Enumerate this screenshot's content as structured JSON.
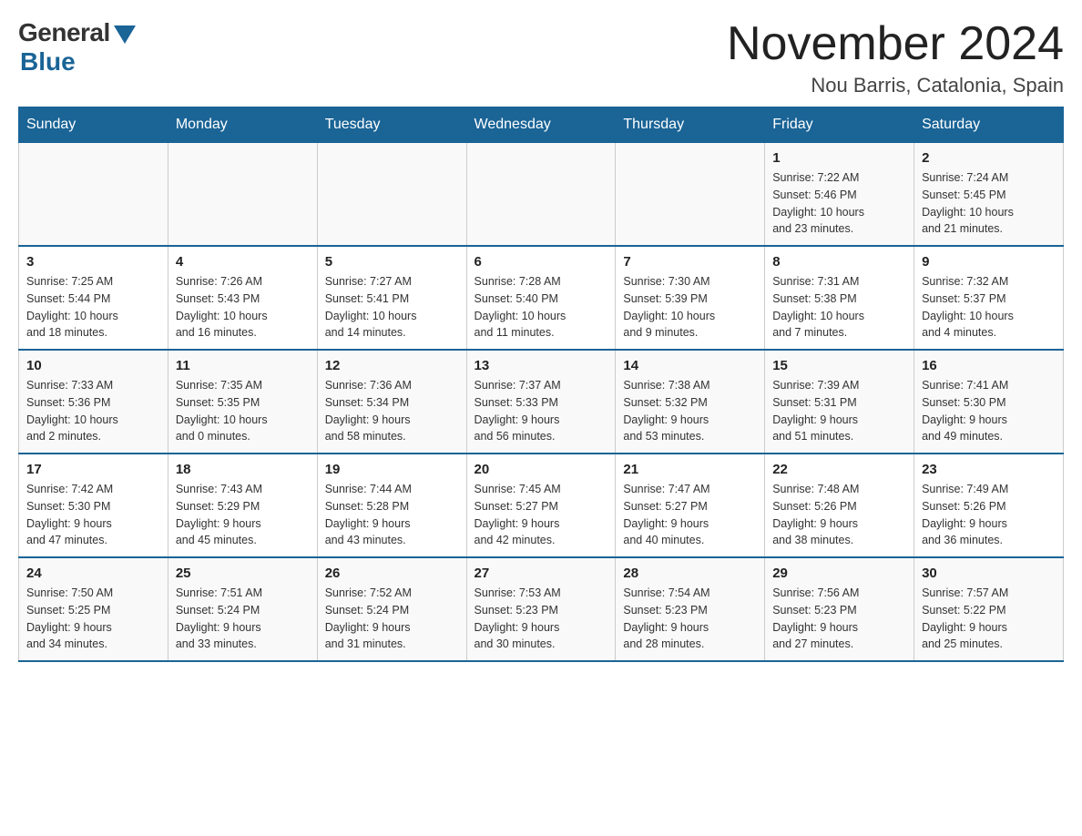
{
  "logo": {
    "general": "General",
    "blue": "Blue"
  },
  "title": "November 2024",
  "location": "Nou Barris, Catalonia, Spain",
  "weekdays": [
    "Sunday",
    "Monday",
    "Tuesday",
    "Wednesday",
    "Thursday",
    "Friday",
    "Saturday"
  ],
  "weeks": [
    [
      {
        "day": "",
        "info": ""
      },
      {
        "day": "",
        "info": ""
      },
      {
        "day": "",
        "info": ""
      },
      {
        "day": "",
        "info": ""
      },
      {
        "day": "",
        "info": ""
      },
      {
        "day": "1",
        "info": "Sunrise: 7:22 AM\nSunset: 5:46 PM\nDaylight: 10 hours\nand 23 minutes."
      },
      {
        "day": "2",
        "info": "Sunrise: 7:24 AM\nSunset: 5:45 PM\nDaylight: 10 hours\nand 21 minutes."
      }
    ],
    [
      {
        "day": "3",
        "info": "Sunrise: 7:25 AM\nSunset: 5:44 PM\nDaylight: 10 hours\nand 18 minutes."
      },
      {
        "day": "4",
        "info": "Sunrise: 7:26 AM\nSunset: 5:43 PM\nDaylight: 10 hours\nand 16 minutes."
      },
      {
        "day": "5",
        "info": "Sunrise: 7:27 AM\nSunset: 5:41 PM\nDaylight: 10 hours\nand 14 minutes."
      },
      {
        "day": "6",
        "info": "Sunrise: 7:28 AM\nSunset: 5:40 PM\nDaylight: 10 hours\nand 11 minutes."
      },
      {
        "day": "7",
        "info": "Sunrise: 7:30 AM\nSunset: 5:39 PM\nDaylight: 10 hours\nand 9 minutes."
      },
      {
        "day": "8",
        "info": "Sunrise: 7:31 AM\nSunset: 5:38 PM\nDaylight: 10 hours\nand 7 minutes."
      },
      {
        "day": "9",
        "info": "Sunrise: 7:32 AM\nSunset: 5:37 PM\nDaylight: 10 hours\nand 4 minutes."
      }
    ],
    [
      {
        "day": "10",
        "info": "Sunrise: 7:33 AM\nSunset: 5:36 PM\nDaylight: 10 hours\nand 2 minutes."
      },
      {
        "day": "11",
        "info": "Sunrise: 7:35 AM\nSunset: 5:35 PM\nDaylight: 10 hours\nand 0 minutes."
      },
      {
        "day": "12",
        "info": "Sunrise: 7:36 AM\nSunset: 5:34 PM\nDaylight: 9 hours\nand 58 minutes."
      },
      {
        "day": "13",
        "info": "Sunrise: 7:37 AM\nSunset: 5:33 PM\nDaylight: 9 hours\nand 56 minutes."
      },
      {
        "day": "14",
        "info": "Sunrise: 7:38 AM\nSunset: 5:32 PM\nDaylight: 9 hours\nand 53 minutes."
      },
      {
        "day": "15",
        "info": "Sunrise: 7:39 AM\nSunset: 5:31 PM\nDaylight: 9 hours\nand 51 minutes."
      },
      {
        "day": "16",
        "info": "Sunrise: 7:41 AM\nSunset: 5:30 PM\nDaylight: 9 hours\nand 49 minutes."
      }
    ],
    [
      {
        "day": "17",
        "info": "Sunrise: 7:42 AM\nSunset: 5:30 PM\nDaylight: 9 hours\nand 47 minutes."
      },
      {
        "day": "18",
        "info": "Sunrise: 7:43 AM\nSunset: 5:29 PM\nDaylight: 9 hours\nand 45 minutes."
      },
      {
        "day": "19",
        "info": "Sunrise: 7:44 AM\nSunset: 5:28 PM\nDaylight: 9 hours\nand 43 minutes."
      },
      {
        "day": "20",
        "info": "Sunrise: 7:45 AM\nSunset: 5:27 PM\nDaylight: 9 hours\nand 42 minutes."
      },
      {
        "day": "21",
        "info": "Sunrise: 7:47 AM\nSunset: 5:27 PM\nDaylight: 9 hours\nand 40 minutes."
      },
      {
        "day": "22",
        "info": "Sunrise: 7:48 AM\nSunset: 5:26 PM\nDaylight: 9 hours\nand 38 minutes."
      },
      {
        "day": "23",
        "info": "Sunrise: 7:49 AM\nSunset: 5:26 PM\nDaylight: 9 hours\nand 36 minutes."
      }
    ],
    [
      {
        "day": "24",
        "info": "Sunrise: 7:50 AM\nSunset: 5:25 PM\nDaylight: 9 hours\nand 34 minutes."
      },
      {
        "day": "25",
        "info": "Sunrise: 7:51 AM\nSunset: 5:24 PM\nDaylight: 9 hours\nand 33 minutes."
      },
      {
        "day": "26",
        "info": "Sunrise: 7:52 AM\nSunset: 5:24 PM\nDaylight: 9 hours\nand 31 minutes."
      },
      {
        "day": "27",
        "info": "Sunrise: 7:53 AM\nSunset: 5:23 PM\nDaylight: 9 hours\nand 30 minutes."
      },
      {
        "day": "28",
        "info": "Sunrise: 7:54 AM\nSunset: 5:23 PM\nDaylight: 9 hours\nand 28 minutes."
      },
      {
        "day": "29",
        "info": "Sunrise: 7:56 AM\nSunset: 5:23 PM\nDaylight: 9 hours\nand 27 minutes."
      },
      {
        "day": "30",
        "info": "Sunrise: 7:57 AM\nSunset: 5:22 PM\nDaylight: 9 hours\nand 25 minutes."
      }
    ]
  ]
}
